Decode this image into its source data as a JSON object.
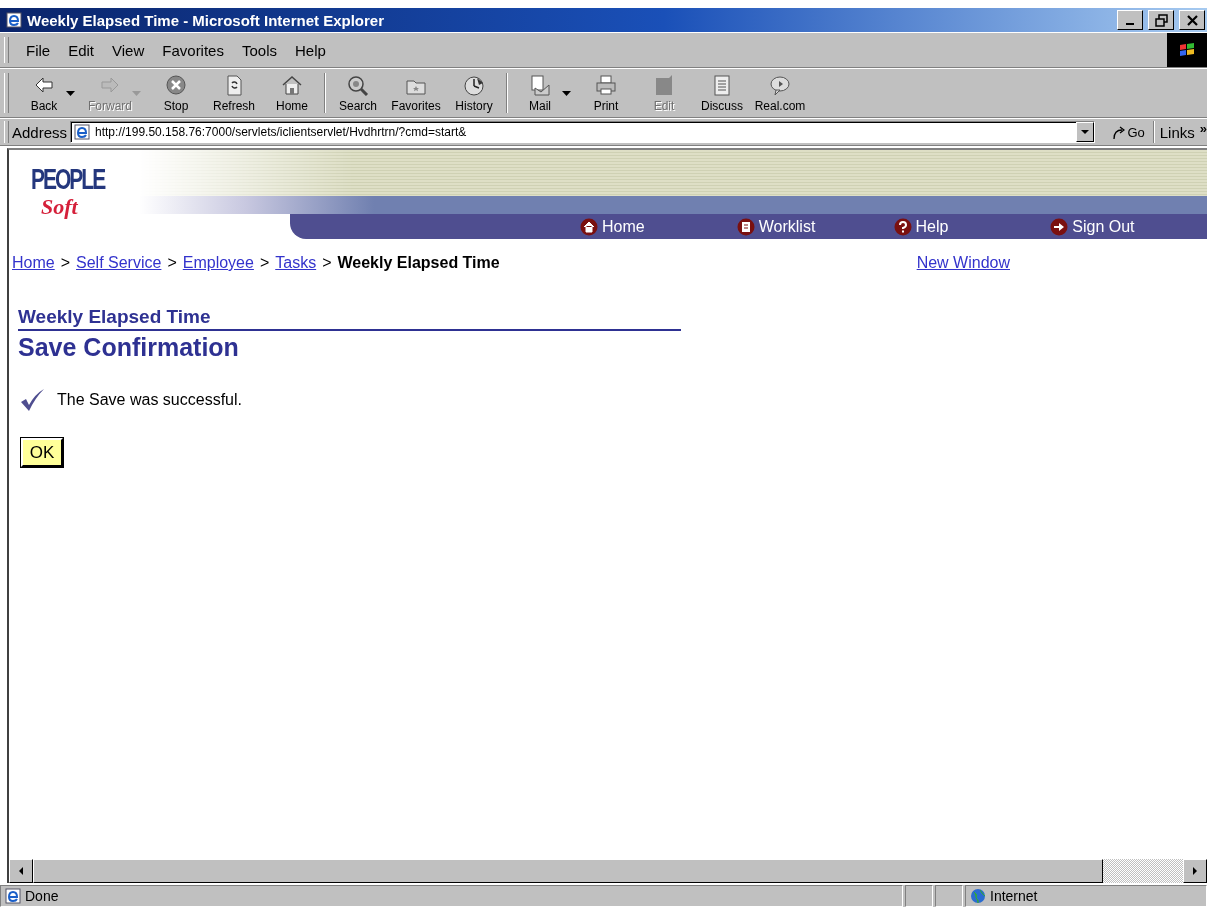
{
  "window": {
    "title": "Weekly Elapsed Time - Microsoft Internet Explorer"
  },
  "menu": [
    "File",
    "Edit",
    "View",
    "Favorites",
    "Tools",
    "Help"
  ],
  "toolbar": {
    "groups": [
      [
        {
          "label": "Back",
          "disabled": false,
          "dropdown": true
        },
        {
          "label": "Forward",
          "disabled": true,
          "dropdown": true
        },
        {
          "label": "Stop",
          "disabled": false,
          "dropdown": false
        },
        {
          "label": "Refresh",
          "disabled": false,
          "dropdown": false
        },
        {
          "label": "Home",
          "disabled": false,
          "dropdown": false
        }
      ],
      [
        {
          "label": "Search",
          "disabled": false,
          "dropdown": false
        },
        {
          "label": "Favorites",
          "disabled": false,
          "dropdown": false
        },
        {
          "label": "History",
          "disabled": false,
          "dropdown": false
        }
      ],
      [
        {
          "label": "Mail",
          "disabled": false,
          "dropdown": true
        },
        {
          "label": "Print",
          "disabled": false,
          "dropdown": false
        },
        {
          "label": "Edit",
          "disabled": true,
          "dropdown": false
        },
        {
          "label": "Discuss",
          "disabled": false,
          "dropdown": false
        },
        {
          "label": "Real.com",
          "disabled": false,
          "dropdown": false
        }
      ]
    ]
  },
  "address": {
    "label": "Address",
    "value": "http://199.50.158.76:7000/servlets/iclientservlet/Hvdhrtrn/?cmd=start&",
    "go": "Go",
    "links": "Links",
    "more": "»"
  },
  "page": {
    "logo": {
      "top": "PEOPLE",
      "bottom": "Soft"
    },
    "nav": [
      "Home",
      "Worklist",
      "Help",
      "Sign Out"
    ],
    "breadcrumb": {
      "links": [
        "Home",
        "Self Service",
        "Employee",
        "Tasks"
      ],
      "separator": ">",
      "current": "Weekly Elapsed Time"
    },
    "new_window": "New Window",
    "section_title": "Weekly Elapsed Time",
    "heading": "Save Confirmation",
    "message": "The Save was successful.",
    "ok_button": "OK"
  },
  "status_bar": {
    "status": "Done",
    "zone": "Internet"
  }
}
